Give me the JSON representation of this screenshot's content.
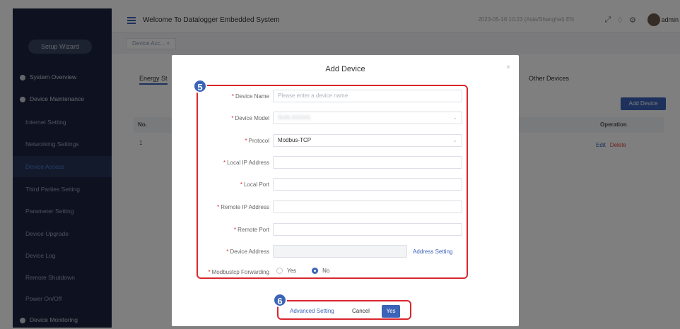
{
  "app": {
    "title": "Welcome To Datalogger Embedded System",
    "top_right_info": "2023-05-18 10:23 (Asia/Shanghai)  EN",
    "user": "admin"
  },
  "sidebar": {
    "wizard": "Setup Wizard",
    "items": [
      {
        "label": "System Overview",
        "type": "section"
      },
      {
        "label": "Device Maintenance",
        "type": "section"
      },
      {
        "label": "Internet Setting",
        "type": "item"
      },
      {
        "label": "Networking Settings",
        "type": "item"
      },
      {
        "label": "Device Access",
        "type": "item",
        "active": true
      },
      {
        "label": "Third Parties Setting",
        "type": "item"
      },
      {
        "label": "Parameter Setting",
        "type": "item"
      },
      {
        "label": "Device Upgrade",
        "type": "item"
      },
      {
        "label": "Device Log",
        "type": "item"
      },
      {
        "label": "Remote Shutdown",
        "type": "item"
      },
      {
        "label": "Power On/Off",
        "type": "item"
      },
      {
        "label": "Device Monitoring",
        "type": "section"
      }
    ]
  },
  "breadcrumb_tab": "Device Acc... ×",
  "main": {
    "tab_energy": "Energy St",
    "tab_other": "Other Devices",
    "add_device": "Add Device",
    "col_no": "No.",
    "col_operation": "Operation",
    "row_no": "1",
    "edit": "Edit",
    "delete": "Delete"
  },
  "modal": {
    "title": "Add Device",
    "close": "×",
    "badge5": "5",
    "badge6": "6",
    "fields": {
      "device_name": {
        "label": "Device Name",
        "placeholder": "Please enter a device name"
      },
      "device_model": {
        "label": "Device Model",
        "value": "SUN-XXXXX"
      },
      "protocol": {
        "label": "Protocol",
        "value": "Modbus-TCP"
      },
      "local_ip": {
        "label": "Local IP Address"
      },
      "local_port": {
        "label": "Local Port"
      },
      "remote_ip": {
        "label": "Remote IP Address"
      },
      "remote_port": {
        "label": "Remote Port"
      },
      "device_address": {
        "label": "Device Address",
        "link": "Address Setting"
      },
      "modbustcp_forwarding": {
        "label": "Modbustcp Forwarding",
        "yes": "Yes",
        "no": "No",
        "selected": "No"
      }
    },
    "footer": {
      "advanced": "Advanced Setting",
      "cancel": "Cancel",
      "yes": "Yes"
    }
  },
  "colors": {
    "accent": "#3b63b8",
    "highlight": "#d9262e",
    "sidebar": "#1d2541"
  }
}
